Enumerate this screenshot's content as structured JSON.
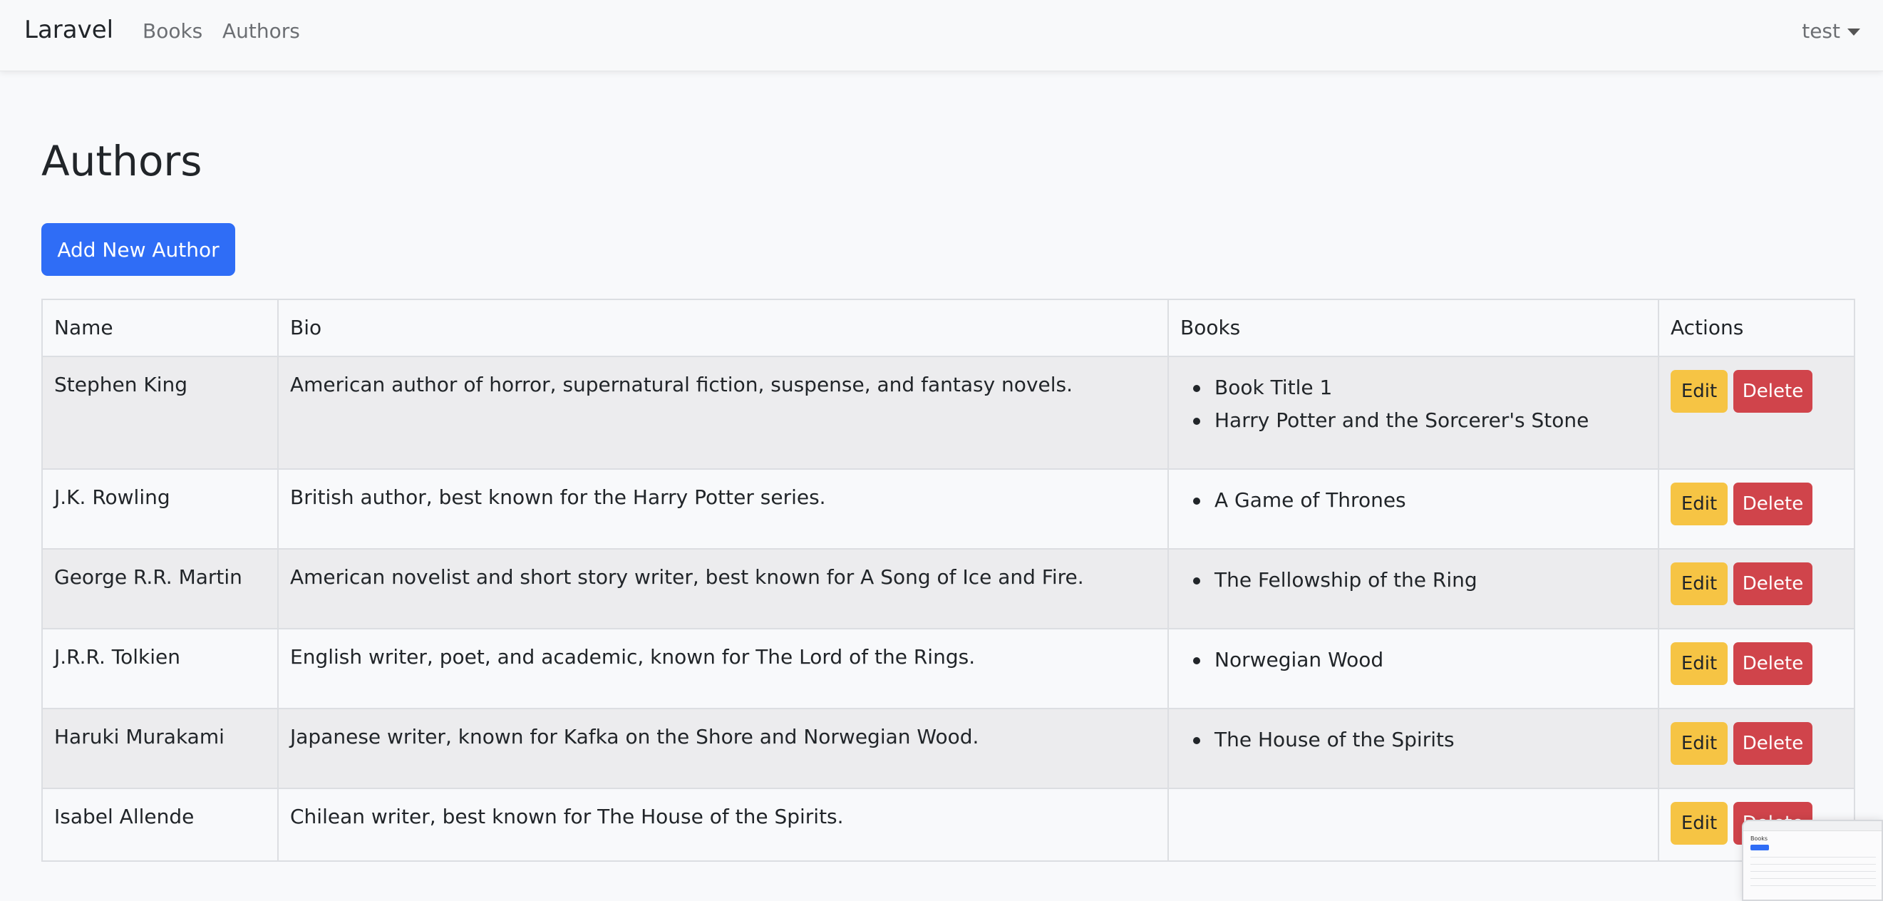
{
  "navbar": {
    "brand": "Laravel",
    "links": [
      "Books",
      "Authors"
    ],
    "user": "test"
  },
  "page": {
    "title": "Authors",
    "add_button": "Add New Author"
  },
  "table": {
    "headers": [
      "Name",
      "Bio",
      "Books",
      "Actions"
    ],
    "edit_label": "Edit",
    "delete_label": "Delete",
    "rows": [
      {
        "name": "Stephen King",
        "bio": "American author of horror, supernatural fiction, suspense, and fantasy novels.",
        "books": [
          "Book Title 1",
          "Harry Potter and the Sorcerer's Stone"
        ]
      },
      {
        "name": "J.K. Rowling",
        "bio": "British author, best known for the Harry Potter series.",
        "books": [
          "A Game of Thrones"
        ]
      },
      {
        "name": "George R.R. Martin",
        "bio": "American novelist and short story writer, best known for A Song of Ice and Fire.",
        "books": [
          "The Fellowship of the Ring"
        ]
      },
      {
        "name": "J.R.R. Tolkien",
        "bio": "English writer, poet, and academic, known for The Lord of the Rings.",
        "books": [
          "Norwegian Wood"
        ]
      },
      {
        "name": "Haruki Murakami",
        "bio": "Japanese writer, known for Kafka on the Shore and Norwegian Wood.",
        "books": [
          "The House of the Spirits"
        ]
      },
      {
        "name": "Isabel Allende",
        "bio": "Chilean writer, best known for The House of the Spirits.",
        "books": []
      }
    ]
  },
  "thumbnail": {
    "title": "Books"
  },
  "colors": {
    "primary": "#2f6df6",
    "warning": "#f6c444",
    "danger": "#d0444b"
  }
}
